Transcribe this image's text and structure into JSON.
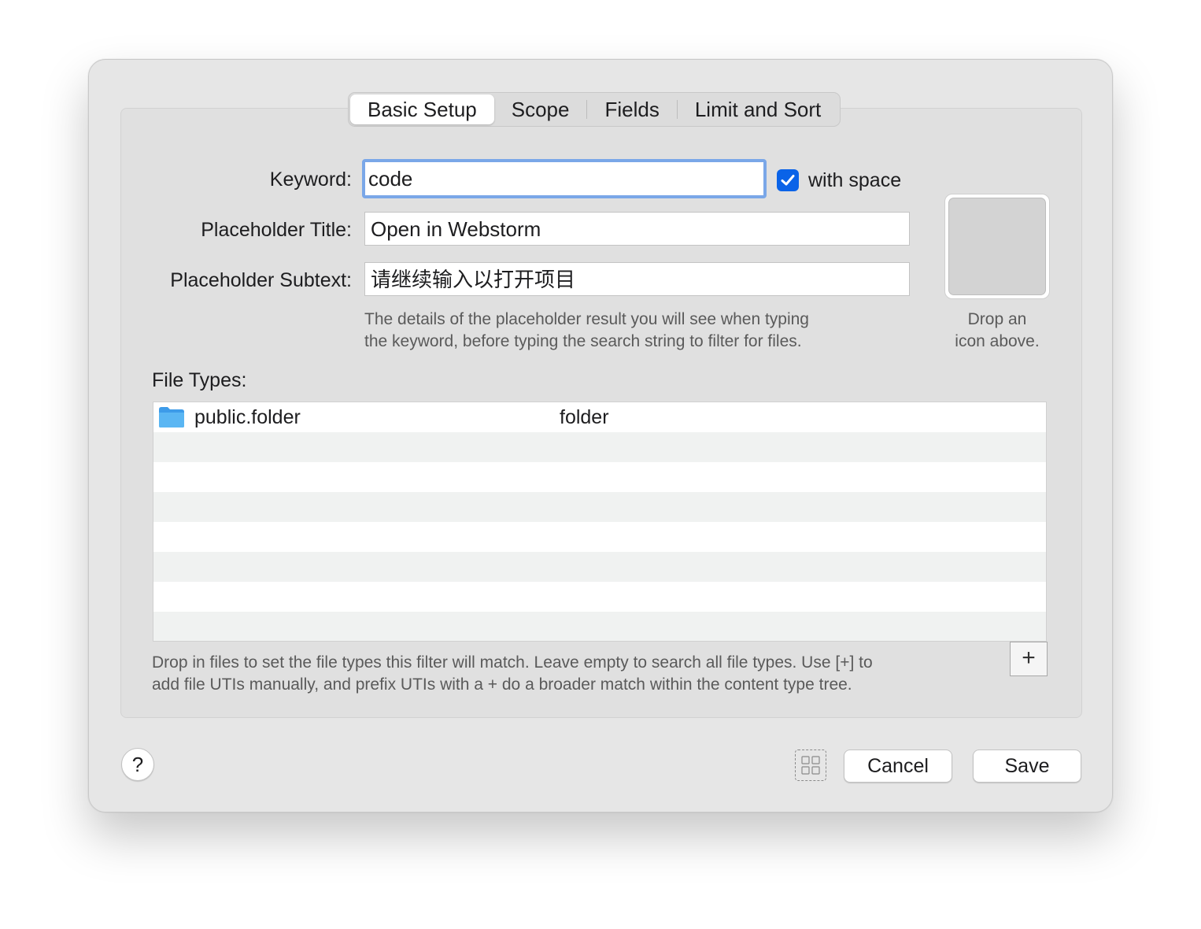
{
  "tabs": [
    {
      "label": "Basic Setup",
      "active": true
    },
    {
      "label": "Scope",
      "active": false
    },
    {
      "label": "Fields",
      "active": false
    },
    {
      "label": "Limit and Sort",
      "active": false
    }
  ],
  "form": {
    "keyword_label": "Keyword:",
    "keyword_value": "code",
    "with_space_label": "with space",
    "with_space_checked": true,
    "placeholder_title_label": "Placeholder Title:",
    "placeholder_title_value": "Open in Webstorm",
    "placeholder_subtext_label": "Placeholder Subtext:",
    "placeholder_subtext_value": "请继续输入以打开项目",
    "hint_line1": "The details of the placeholder result you will see when typing",
    "hint_line2": "the keyword, before typing the search string to filter for files."
  },
  "icon_well": {
    "hint_line1": "Drop an",
    "hint_line2": "icon above."
  },
  "file_types": {
    "label": "File Types:",
    "rows": [
      {
        "uti": "public.folder",
        "description": "folder",
        "icon": "folder-icon"
      }
    ],
    "empty_rows": 7,
    "hint_line1": "Drop in files to set the file types this filter will match. Leave empty to search all file types. Use [+] to",
    "hint_line2": "add file UTIs manually, and prefix UTIs with a + do a broader match within the content type tree.",
    "add_label": "+"
  },
  "footer": {
    "help_label": "?",
    "cancel_label": "Cancel",
    "save_label": "Save"
  },
  "colors": {
    "accent": "#0a63e8",
    "focus_ring": "#7aa7e8",
    "folder": "#5ab0f0"
  }
}
